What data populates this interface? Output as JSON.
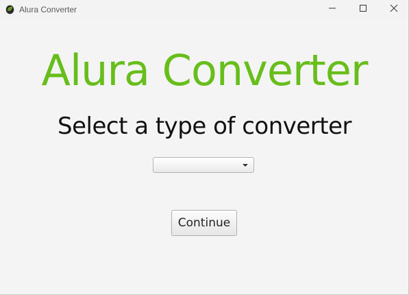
{
  "window": {
    "title": "Alura Converter",
    "controls": [
      "minimize-icon",
      "maximize-icon",
      "close-icon"
    ]
  },
  "main": {
    "heading": "Alura Converter",
    "prompt": "Select a type of converter",
    "converter_select": {
      "selected_value": ""
    },
    "continue_label": "Continue"
  },
  "colors": {
    "heading": "#67be1b",
    "background": "#f4f4f4"
  }
}
